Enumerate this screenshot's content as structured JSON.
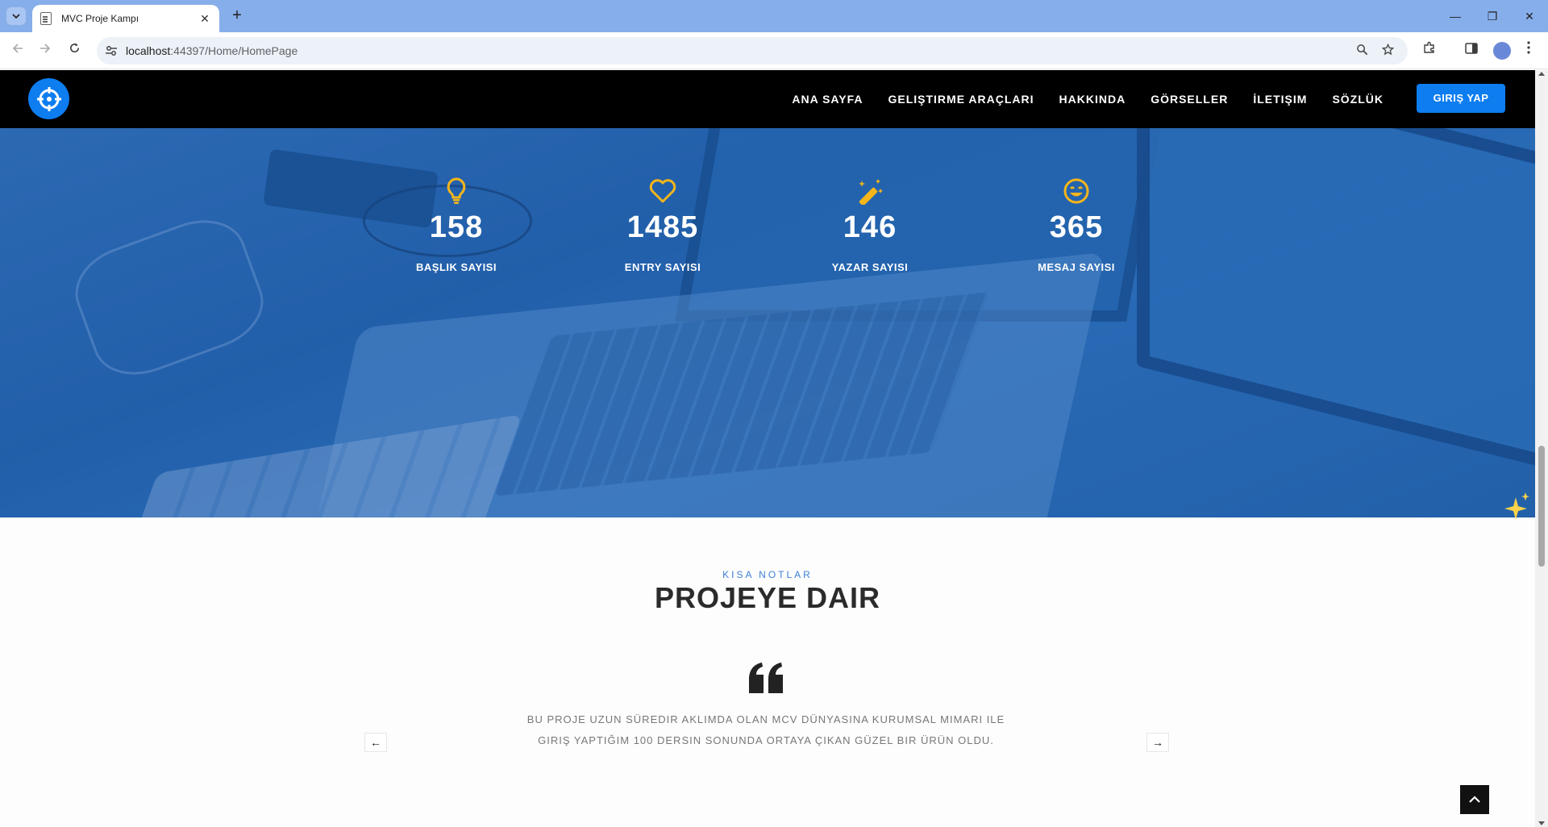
{
  "browser": {
    "tab_title": "MVC Proje Kampı",
    "tab_close": "✕",
    "new_tab": "+",
    "url_host": "localhost",
    "url_rest": ":44397/Home/HomePage",
    "window_controls": {
      "minimize": "—",
      "restore": "❐",
      "close": "✕"
    }
  },
  "header": {
    "nav": [
      "ANA SAYFA",
      "GELIŞTIRME ARAÇLARI",
      "HAKKINDA",
      "GÖRSELLER",
      "İLETIŞIM",
      "SÖZLÜK"
    ],
    "login": "GIRIŞ YAP"
  },
  "stats": [
    {
      "icon": "lightbulb-icon",
      "value": "158",
      "label": "BAŞLIK SAYISI"
    },
    {
      "icon": "heart-icon",
      "value": "1485",
      "label": "ENTRY SAYISI"
    },
    {
      "icon": "magic-wand-icon",
      "value": "146",
      "label": "YAZAR SAYISI"
    },
    {
      "icon": "grin-icon",
      "value": "365",
      "label": "MESAJ SAYISI"
    }
  ],
  "notes": {
    "subtitle": "KISA NOTLAR",
    "title": "PROJEYE DAIR",
    "quote_line1": "BU PROJE UZUN SÜREDIR AKLIMDA OLAN MCV DÜNYASINA KURUMSAL MIMARI ILE",
    "quote_line2": "GIRIŞ YAPTIĞIM 100 DERSIN SONUNDA ORTAYA ÇIKAN GÜZEL BIR ÜRÜN OLDU.",
    "prev": "←",
    "next": "→"
  },
  "colors": {
    "accent": "#0d7df0",
    "icon_yellow": "#f5b51b",
    "header_bg": "#000000"
  }
}
